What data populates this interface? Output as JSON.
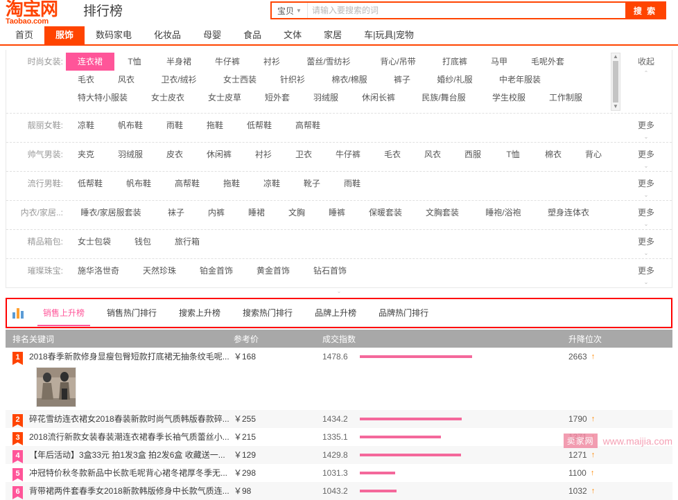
{
  "header": {
    "logo_main": "淘宝网",
    "logo_sub": "Taobao.com",
    "site_title": "排行榜",
    "search": {
      "category": "宝贝",
      "placeholder": "请输入要搜索的词",
      "value": "",
      "button": "搜 索"
    }
  },
  "nav": {
    "items": [
      {
        "label": "首页",
        "active": false
      },
      {
        "label": "服饰",
        "active": true
      },
      {
        "label": "数码家电",
        "active": false
      },
      {
        "label": "化妆品",
        "active": false
      },
      {
        "label": "母婴",
        "active": false
      },
      {
        "label": "食品",
        "active": false
      },
      {
        "label": "文体",
        "active": false
      },
      {
        "label": "家居",
        "active": false
      },
      {
        "label": "车|玩具|宠物",
        "active": false
      }
    ]
  },
  "categories": {
    "collapse_label": "收起",
    "more_label": "更多",
    "rows": [
      {
        "label": "时尚女装",
        "action": "收起",
        "items": [
          {
            "name": "连衣裙",
            "highlight": true
          },
          {
            "name": "T恤"
          },
          {
            "name": "半身裙"
          },
          {
            "name": "牛仔裤"
          },
          {
            "name": "衬衫"
          },
          {
            "name": "蕾丝/雪纺衫"
          },
          {
            "name": "背心/吊带"
          },
          {
            "name": "打底裤"
          },
          {
            "name": "马甲"
          },
          {
            "name": "毛呢外套"
          },
          {
            "name": "毛衣"
          },
          {
            "name": "风衣"
          },
          {
            "name": "卫衣/绒衫"
          },
          {
            "name": "女士西装"
          },
          {
            "name": "针织衫"
          },
          {
            "name": "棉衣/棉服"
          },
          {
            "name": "裤子"
          },
          {
            "name": "婚纱/礼服"
          },
          {
            "name": "中老年服装"
          },
          {
            "name": "特大特小服装"
          },
          {
            "name": "女士皮衣"
          },
          {
            "name": "女士皮草"
          },
          {
            "name": "短外套"
          },
          {
            "name": "羽绒服"
          },
          {
            "name": "休闲长裤"
          },
          {
            "name": "民族/舞台服"
          },
          {
            "name": "学生校服"
          },
          {
            "name": "工作制服"
          }
        ]
      },
      {
        "label": "靓丽女鞋",
        "action": "更多",
        "items": [
          {
            "name": "凉鞋"
          },
          {
            "name": "帆布鞋"
          },
          {
            "name": "雨鞋"
          },
          {
            "name": "拖鞋"
          },
          {
            "name": "低帮鞋"
          },
          {
            "name": "高帮鞋"
          }
        ]
      },
      {
        "label": "帅气男装",
        "action": "更多",
        "items": [
          {
            "name": "夹克"
          },
          {
            "name": "羽绒服"
          },
          {
            "name": "皮衣"
          },
          {
            "name": "休闲裤"
          },
          {
            "name": "衬衫"
          },
          {
            "name": "卫衣"
          },
          {
            "name": "牛仔裤"
          },
          {
            "name": "毛衣"
          },
          {
            "name": "风衣"
          },
          {
            "name": "西服"
          },
          {
            "name": "T恤"
          },
          {
            "name": "棉衣"
          },
          {
            "name": "背心"
          }
        ]
      },
      {
        "label": "流行男鞋",
        "action": "更多",
        "items": [
          {
            "name": "低帮鞋"
          },
          {
            "name": "帆布鞋"
          },
          {
            "name": "高帮鞋"
          },
          {
            "name": "拖鞋"
          },
          {
            "name": "凉鞋"
          },
          {
            "name": "靴子"
          },
          {
            "name": "雨鞋"
          }
        ]
      },
      {
        "label": "内衣/家居..",
        "action": "更多",
        "items": [
          {
            "name": "睡衣/家居服套装"
          },
          {
            "name": "袜子"
          },
          {
            "name": "内裤"
          },
          {
            "name": "睡裙"
          },
          {
            "name": "文胸"
          },
          {
            "name": "睡裤"
          },
          {
            "name": "保暖套装"
          },
          {
            "name": "文胸套装"
          },
          {
            "name": "睡袍/浴袍"
          },
          {
            "name": "塑身连体衣"
          }
        ]
      },
      {
        "label": "精品箱包",
        "action": "更多",
        "items": [
          {
            "name": "女士包袋"
          },
          {
            "name": "钱包"
          },
          {
            "name": "旅行箱"
          }
        ]
      },
      {
        "label": "璀璨珠宝",
        "action": "更多",
        "items": [
          {
            "name": "施华洛世奇"
          },
          {
            "name": "天然珍珠"
          },
          {
            "name": "铂金首饰"
          },
          {
            "name": "黄金首饰"
          },
          {
            "name": "钻石首饰"
          }
        ]
      }
    ]
  },
  "tabs": [
    {
      "label": "销售上升榜",
      "active": true
    },
    {
      "label": "销售热门排行",
      "active": false
    },
    {
      "label": "搜索上升榜",
      "active": false
    },
    {
      "label": "搜索热门排行",
      "active": false
    },
    {
      "label": "品牌上升榜",
      "active": false
    },
    {
      "label": "品牌热门排行",
      "active": false
    }
  ],
  "table": {
    "headers": {
      "rank": "排名",
      "keyword": "关键词",
      "price": "参考价",
      "index": "成交指数",
      "change": "升降位次"
    },
    "rows": [
      {
        "rank": "1",
        "keyword": "2018春季新款修身显瘦包臀短款打底裙无抽条纹毛呢...",
        "price": "￥168",
        "index": "1478.6",
        "change": "2663",
        "direction": "up",
        "has_thumb": true
      },
      {
        "rank": "2",
        "keyword": "碎花雪纺连衣裙女2018春装新款时尚气质韩版春款碎...",
        "price": "￥255",
        "index": "1434.2",
        "change": "1790",
        "direction": "up",
        "has_thumb": false
      },
      {
        "rank": "3",
        "keyword": "2018流行新款女装春装潮连衣裙春季长袖气质蕾丝小...",
        "price": "￥215",
        "index": "1335.1",
        "change": "1371",
        "direction": "up",
        "has_thumb": false
      },
      {
        "rank": "4",
        "keyword": "【年后活动】3盒33元 拍1发3盒 拍2发6盒 收藏送一...",
        "price": "￥129",
        "index": "1429.8",
        "change": "1271",
        "direction": "up",
        "has_thumb": false
      },
      {
        "rank": "5",
        "keyword": "冲冠特价秋冬款新品中长款毛呢背心裙冬裙厚冬季无...",
        "price": "￥298",
        "index": "1031.3",
        "change": "1100",
        "direction": "up",
        "has_thumb": false
      },
      {
        "rank": "6",
        "keyword": "背带裙两件套春季女2018新款韩版修身中长款气质连...",
        "price": "￥98",
        "index": "1043.2",
        "change": "1032",
        "direction": "up",
        "has_thumb": false
      }
    ]
  },
  "watermark": {
    "badge": "卖家网",
    "url": "www.maijia.com"
  },
  "chart_data": {
    "type": "bar",
    "title": "成交指数",
    "categories": [
      "1",
      "2",
      "3",
      "4",
      "5",
      "6"
    ],
    "values": [
      1478.6,
      1434.2,
      1335.1,
      1429.8,
      1031.3,
      1043.2
    ],
    "xlabel": "排名",
    "ylabel": "成交指数",
    "ylim": [
      0,
      1500
    ]
  },
  "colors": {
    "brand_orange": "#ff4400",
    "accent_pink": "#ff5599",
    "bar_pink": "#f4689b",
    "header_gray": "#a8a8a8",
    "highlight_box": "#ff0000"
  }
}
